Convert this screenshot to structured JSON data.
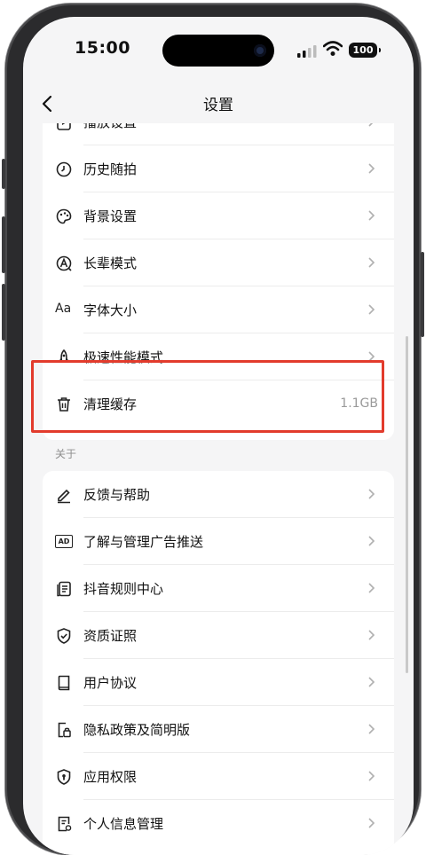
{
  "status_bar": {
    "time": "15:00",
    "battery": "100"
  },
  "nav": {
    "title": "设置"
  },
  "general_items": [
    {
      "label": "播放设置",
      "icon": "play-square-icon"
    },
    {
      "label": "历史随拍",
      "icon": "history-clock-icon"
    },
    {
      "label": "背景设置",
      "icon": "palette-icon"
    },
    {
      "label": "长辈模式",
      "icon": "elder-mode-icon"
    },
    {
      "label": "字体大小",
      "icon": "font-size-icon",
      "glyph": "Aa"
    },
    {
      "label": "极速性能模式",
      "icon": "rocket-icon"
    },
    {
      "label": "清理缓存",
      "icon": "trash-icon",
      "value": "1.1GB"
    }
  ],
  "about": {
    "section_label": "关于",
    "items": [
      {
        "label": "反馈与帮助",
        "icon": "pen-icon"
      },
      {
        "label": "了解与管理广告推送",
        "icon": "ad-icon",
        "glyph": "AD"
      },
      {
        "label": "抖音规则中心",
        "icon": "rules-document-icon"
      },
      {
        "label": "资质证照",
        "icon": "shield-check-icon"
      },
      {
        "label": "用户协议",
        "icon": "book-icon"
      },
      {
        "label": "隐私政策及简明版",
        "icon": "privacy-lock-icon"
      },
      {
        "label": "应用权限",
        "icon": "shield-keyhole-icon"
      },
      {
        "label": "个人信息管理",
        "icon": "personal-info-icon"
      }
    ]
  },
  "colors": {
    "highlight": "#e23b2c",
    "background": "#f5f5f6"
  }
}
